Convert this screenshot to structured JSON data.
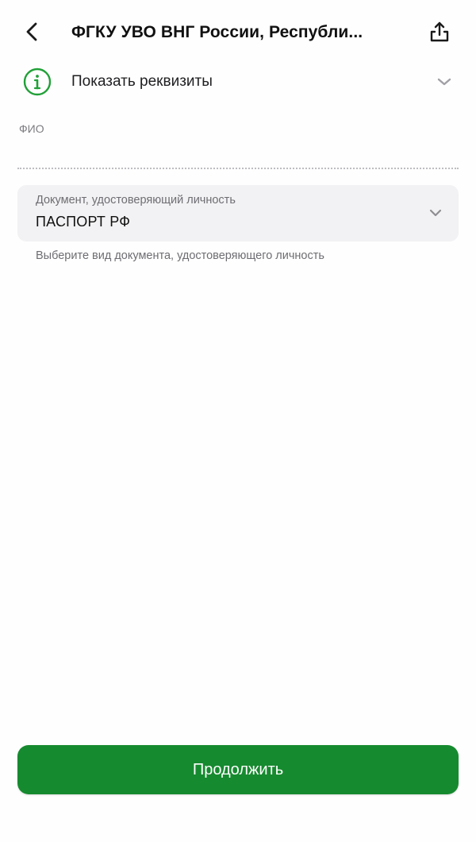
{
  "header": {
    "title": "ФГКУ УВО ВНГ России, Республи...",
    "back_icon": "chevron-left-icon",
    "share_icon": "share-icon"
  },
  "requisites": {
    "label": "Показать реквизиты",
    "icon": "info-icon",
    "expand_icon": "chevron-down-icon"
  },
  "fio": {
    "label": "ФИО",
    "value": ""
  },
  "document": {
    "label": "Документ, удостоверяющий личность",
    "value": "ПАСПОРТ РФ",
    "hint": "Выберите вид документа, удостоверяющего личность",
    "expand_icon": "chevron-down-icon"
  },
  "footer": {
    "continue_label": "Продолжить"
  },
  "colors": {
    "accent": "#168a2f",
    "info_icon": "#21a038",
    "field_bg": "#f2f2f4",
    "muted_text": "#6e6e73"
  }
}
